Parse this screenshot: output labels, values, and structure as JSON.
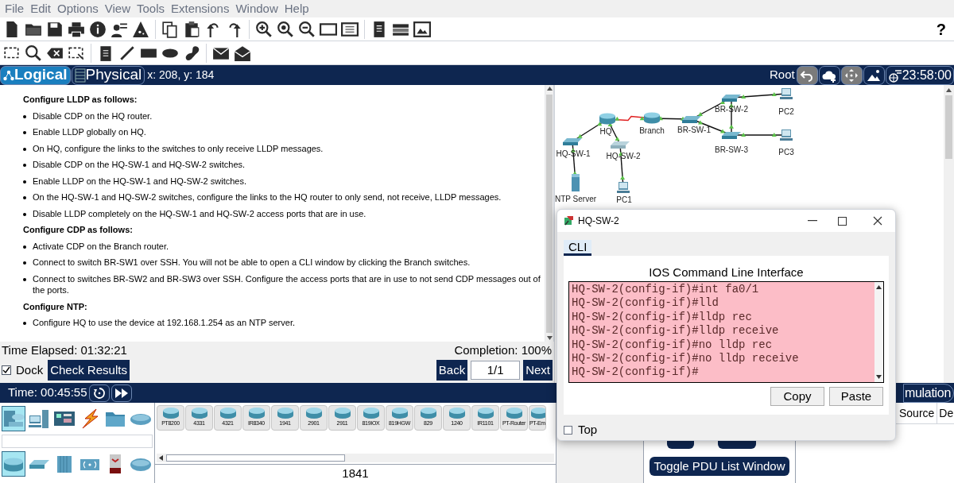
{
  "menu": [
    "File",
    "Edit",
    "Options",
    "View",
    "Tools",
    "Extensions",
    "Window",
    "Help"
  ],
  "help": "?",
  "view_tabs": [
    {
      "label": "Logical",
      "selected": true
    },
    {
      "label": "Physical",
      "selected": false
    }
  ],
  "coordinates": "x: 208, y: 184",
  "workspace_bar": {
    "path": "Root",
    "clock": "23:58:00"
  },
  "instructions": [
    {
      "kind": "heading",
      "text": "Configure LLDP as follows:"
    },
    {
      "kind": "bullet",
      "text": "Disable CDP on the HQ router."
    },
    {
      "kind": "bullet",
      "text": "Enable LLDP globally on HQ."
    },
    {
      "kind": "bullet",
      "text": "On HQ, configure the links to the switches to only receive LLDP messages."
    },
    {
      "kind": "bullet",
      "text": "Disable CDP on the HQ-SW-1 and HQ-SW-2 switches."
    },
    {
      "kind": "bullet",
      "text": "Enable LLDP on the HQ-SW-1 and HQ-SW-2 switches."
    },
    {
      "kind": "bullet",
      "text": "On the HQ-SW-1 and HQ-SW-2 switches, configure the links to the HQ router to only send, not receive, LLDP messages."
    },
    {
      "kind": "bullet",
      "text": "Disable LLDP completely on the HQ-SW-1 and HQ-SW-2 access ports that are in use."
    },
    {
      "kind": "heading",
      "text": "Configure CDP as follows:"
    },
    {
      "kind": "bullet",
      "text": "Activate CDP on the Branch router."
    },
    {
      "kind": "bullet",
      "text": "Connect to switch BR-SW1 over SSH. You will not be able to open a CLI window by clicking the Branch switches."
    },
    {
      "kind": "bullet",
      "text": "Connect to switches BR-SW2 and BR-SW3 over SSH. Configure the access ports that are in use to not send CDP messages out of the ports."
    },
    {
      "kind": "heading",
      "text": "Configure NTP:"
    },
    {
      "kind": "bullet",
      "text": "Configure HQ to use the device at 192.168.1.254 as an NTP server."
    }
  ],
  "activity": {
    "time_elapsed": "Time Elapsed: 01:32:21",
    "completion": "Completion: 100%",
    "dock": {
      "label": "Dock",
      "checked": true
    },
    "check_results": "Check Results",
    "back": "Back",
    "page": "1/1",
    "next": "Next"
  },
  "topology": {
    "devices": [
      {
        "label": "BR-SW-2",
        "kind": "switch"
      },
      {
        "label": "PC2",
        "kind": "pc"
      },
      {
        "label": "HQ",
        "kind": "router"
      },
      {
        "label": "Branch",
        "kind": "router"
      },
      {
        "label": "BR-SW-1",
        "kind": "switch"
      },
      {
        "label": "HQ-SW-1",
        "kind": "switch"
      },
      {
        "label": "HQ-SW-2",
        "kind": "switch"
      },
      {
        "label": "BR-SW-3",
        "kind": "switch"
      },
      {
        "label": "PC3",
        "kind": "pc"
      },
      {
        "label": "NTP Server",
        "kind": "server"
      },
      {
        "label": "PC1",
        "kind": "pc"
      }
    ],
    "links": [
      {
        "kind": "serial"
      },
      {
        "kind": "ethernet"
      },
      {
        "kind": "ethernet"
      },
      {
        "kind": "ethernet"
      },
      {
        "kind": "ethernet"
      },
      {
        "kind": "ethernet"
      },
      {
        "kind": "ethernet"
      },
      {
        "kind": "ethernet"
      },
      {
        "kind": "ethernet"
      },
      {
        "kind": "ethernet"
      },
      {
        "kind": "ethernet"
      }
    ]
  },
  "sim_bar": {
    "time": "Time: 00:45:55",
    "mode": "mulation"
  },
  "device_categories": [
    {
      "kind": "network",
      "selected": true
    },
    {
      "kind": "end",
      "selected": false
    },
    {
      "kind": "components",
      "selected": false
    },
    {
      "kind": "connections",
      "selected": false
    },
    {
      "kind": "misc",
      "selected": false
    },
    {
      "kind": "multiuser",
      "selected": false
    }
  ],
  "device_types": [
    {
      "kind": "router",
      "selected": true
    },
    {
      "kind": "switch",
      "selected": false
    },
    {
      "kind": "hub",
      "selected": false
    },
    {
      "kind": "wireless",
      "selected": false
    },
    {
      "kind": "security",
      "selected": false
    },
    {
      "kind": "wan",
      "selected": false
    }
  ],
  "device_models": [
    "PT8200",
    "4331",
    "4321",
    "IR8340",
    "1941",
    "2901",
    "2911",
    "819IOX",
    "819HGW",
    "829",
    "1240",
    "IR1101",
    "PT-Router",
    "PT-Em"
  ],
  "selected_model": "1841",
  "pdu": {
    "toggle": "Toggle PDU List Window",
    "columns": [
      "Source",
      "De"
    ]
  },
  "cli_window": {
    "title": "HQ-SW-2",
    "tabs": [
      {
        "label": "CLI",
        "selected": true
      }
    ],
    "heading": "IOS Command Line Interface",
    "lines": [
      "HQ-SW-2(config-if)#int fa0/1",
      "HQ-SW-2(config-if)#lld",
      "HQ-SW-2(config-if)#lldp rec",
      "HQ-SW-2(config-if)#lldp receive",
      "HQ-SW-2(config-if)#no lldp rec",
      "HQ-SW-2(config-if)#no lldp receive",
      "HQ-SW-2(config-if)#"
    ],
    "buttons": [
      "Copy",
      "Paste"
    ],
    "top": {
      "label": "Top",
      "checked": false
    }
  }
}
